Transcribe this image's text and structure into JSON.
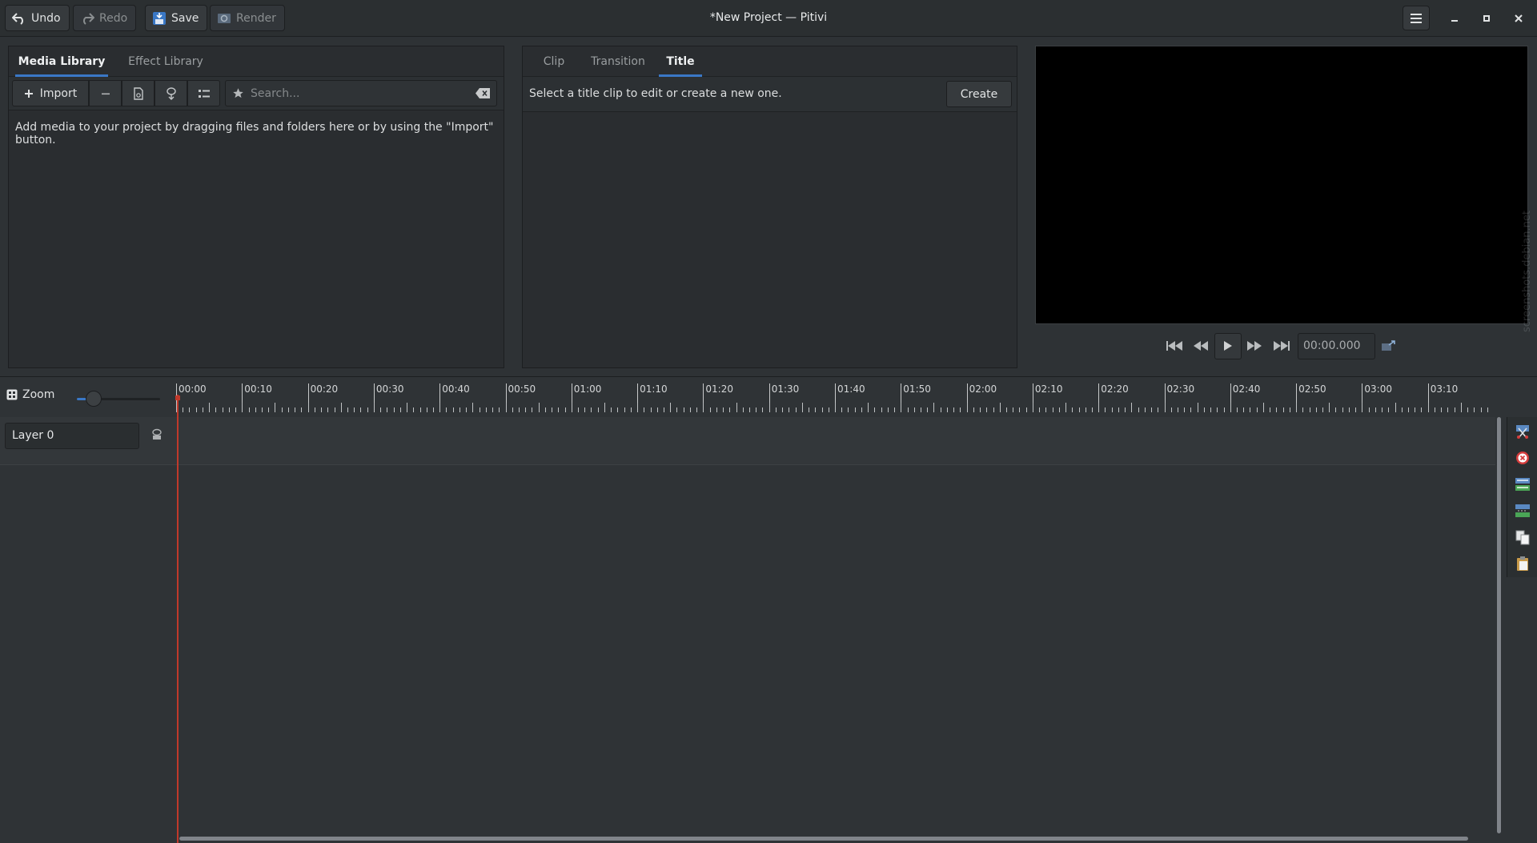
{
  "window": {
    "title": "*New Project — Pitivi",
    "buttons": {
      "undo": "Undo",
      "redo": "Redo",
      "save": "Save",
      "render": "Render"
    }
  },
  "library_pane": {
    "tabs": [
      {
        "label": "Media Library",
        "active": true
      },
      {
        "label": "Effect Library",
        "active": false
      }
    ],
    "toolbar": {
      "import_label": "Import"
    },
    "search": {
      "placeholder": "Search..."
    },
    "hint": "Add media to your project by dragging files and folders here or by using the \"Import\" button."
  },
  "properties_pane": {
    "tabs": [
      {
        "label": "Clip",
        "active": false
      },
      {
        "label": "Transition",
        "active": false
      },
      {
        "label": "Title",
        "active": true
      }
    ],
    "message": "Select a title clip to edit or create a new one.",
    "create_label": "Create"
  },
  "viewer": {
    "timecode": "00:00.000"
  },
  "timeline": {
    "zoom_label": "Zoom",
    "zoom_level": 0.2,
    "ruler_labels": [
      "00:00",
      "00:10",
      "00:20",
      "00:30",
      "00:40",
      "00:50",
      "01:00",
      "01:10",
      "01:20",
      "01:30",
      "01:40",
      "01:50",
      "02:00",
      "02:10",
      "02:20",
      "02:30",
      "02:40",
      "02:50",
      "03:00",
      "03:10"
    ],
    "layers": [
      {
        "name": "Layer 0"
      }
    ]
  },
  "watermark": "screenshots.debian.net",
  "colors": {
    "accent": "#3a78c6",
    "playhead": "#c0392b",
    "background": "#2e3235"
  }
}
